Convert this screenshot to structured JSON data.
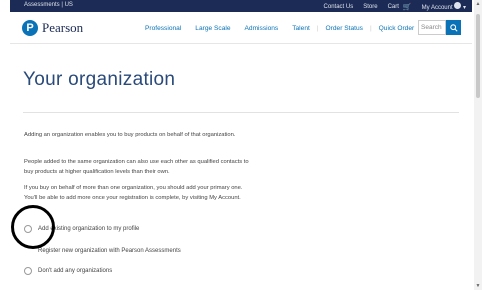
{
  "topbar": {
    "region": "Assessments | US",
    "contact": "Contact Us",
    "store": "Store",
    "cart": "Cart",
    "account": "My Account",
    "colors": {
      "background": "#1c2b55"
    }
  },
  "nav": {
    "logo_text": "Pearson",
    "items": [
      "Professional",
      "Large Scale",
      "Admissions",
      "Talent",
      "Order Status",
      "Quick Order"
    ],
    "search_placeholder": "Search",
    "colors": {
      "link": "#0a72b6",
      "accent": "#0a72b6"
    }
  },
  "page": {
    "title": "Your organization",
    "paragraphs": [
      "Adding an organization enables you to buy products on behalf of that organization.",
      "People added to the same organization can also use each other as qualified contacts to buy products at higher qualification levels than their own.",
      "If you buy on behalf of more than one organization, you should add your primary one. You'll be able to add more once your registration is complete, by visiting My Account."
    ],
    "options": [
      {
        "label": "Add existing organization to my profile"
      },
      {
        "label": "Register new organization with Pearson Assessments"
      },
      {
        "label": "Don't add any organizations"
      }
    ]
  }
}
